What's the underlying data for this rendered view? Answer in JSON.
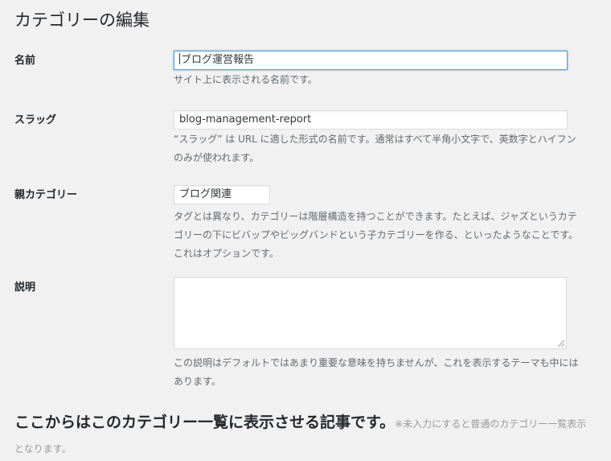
{
  "page": {
    "title": "カテゴリーの編集"
  },
  "fields": {
    "name": {
      "label": "名前",
      "value": "ブログ運営報告",
      "description": "サイト上に表示される名前です。"
    },
    "slug": {
      "label": "スラッグ",
      "value": "blog-management-report",
      "description": "“スラッグ” は URL に適した形式の名前です。通常はすべて半角小文字で、英数字とハイフンのみが使われます。"
    },
    "parent": {
      "label": "親カテゴリー",
      "value": "ブログ関連",
      "description": "タグとは異なり、カテゴリーは階層構造を持つことができます。たとえば、ジャズというカテゴリーの下にビバップやビッグバンドという子カテゴリーを作る、といったようなことです。これはオプションです。"
    },
    "description": {
      "label": "説明",
      "value": "",
      "description": "この説明はデフォルトではあまり重要な意味を持ちませんが、これを表示するテーマも中にはあります。"
    }
  },
  "section": {
    "title": "ここからはこのカテゴリー一覧に表示させる記事です。",
    "note": "※未入力にすると普通のカテゴリー一覧表示となります。"
  },
  "colors": {
    "background": "#f1f1f1",
    "focus_border": "#5b9dd9",
    "text": "#23282d",
    "muted": "#646970"
  }
}
